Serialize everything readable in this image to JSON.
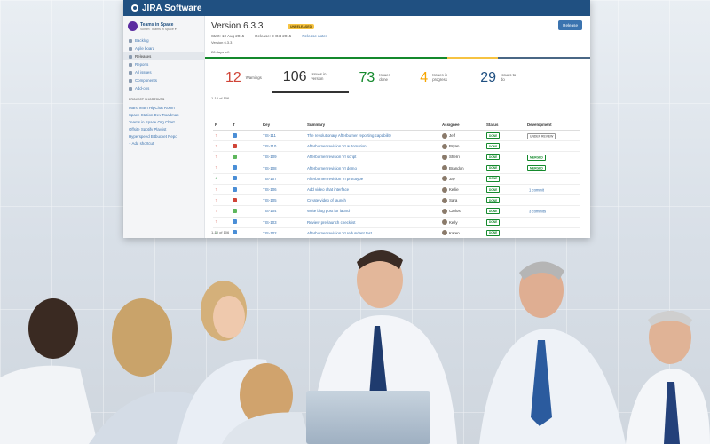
{
  "app": {
    "name": "JIRA Software"
  },
  "project": {
    "name": "Teams in Space",
    "board": "Scrum: Teams in Space ▾"
  },
  "sidebar": {
    "items": [
      {
        "label": "Backlog"
      },
      {
        "label": "Agile board"
      },
      {
        "label": "Releases"
      },
      {
        "label": "Reports"
      },
      {
        "label": "All issues"
      },
      {
        "label": "Components"
      },
      {
        "label": "Add-ons"
      }
    ],
    "shortcuts_heading": "PROJECT SHORTCUTS",
    "shortcuts": [
      "Mars Team HipChat Room",
      "Space Station Dev Roadmap",
      "Teams in Space Org Chart",
      "Offsite Spotify Playlist",
      "Hyperspeed Bitbucket Repo"
    ],
    "add_shortcut": "+ Add shortcut"
  },
  "version": {
    "title": "Version 6.3.3",
    "badge": "UNRELEASED",
    "start": "Start: 10 Aug 2015",
    "release": "Release: 9 Oct 2015",
    "notes_link": "Release notes",
    "subtitle": "Version 6.3.3",
    "release_button": "Release",
    "days_left": "28 days left",
    "progress": {
      "done": 0.63,
      "in_progress": 0.13,
      "todo": 0.24
    }
  },
  "stats": [
    {
      "num": "12",
      "label": "Warnings"
    },
    {
      "num": "106",
      "label": "Issues in version"
    },
    {
      "num": "73",
      "label": "Issues done"
    },
    {
      "num": "4",
      "label": "Issues in progress"
    },
    {
      "num": "29",
      "label": "Issues to-do"
    }
  ],
  "count_label": "1-10 of 106",
  "table": {
    "headers": [
      "P",
      "T",
      "Key",
      "Summary",
      "Assignee",
      "Status",
      "Development"
    ],
    "rows": [
      {
        "pri": "high",
        "type": "task",
        "key": "TIS-111",
        "summary": "The revolutionary Afterburner reporting capability",
        "assignee": "Jeff",
        "status": "DONE",
        "dev": "UNDER REVIEW",
        "dev_kind": "review"
      },
      {
        "pri": "high",
        "type": "bug",
        "key": "TIS-110",
        "summary": "Afterburner revision VI automation",
        "assignee": "Bryan",
        "status": "DONE",
        "dev": "",
        "dev_kind": ""
      },
      {
        "pri": "high",
        "type": "story",
        "key": "TIS-109",
        "summary": "Afterburner revision VI script",
        "assignee": "Sherri",
        "status": "DONE",
        "dev": "MERGED",
        "dev_kind": "merged"
      },
      {
        "pri": "high",
        "type": "task",
        "key": "TIS-108",
        "summary": "Afterburner revision VI demo",
        "assignee": "Brandon",
        "status": "DONE",
        "dev": "MERGED",
        "dev_kind": "merged"
      },
      {
        "pri": "low",
        "type": "task",
        "key": "TIS-107",
        "summary": "Afterburner revision VI prototype",
        "assignee": "Jay",
        "status": "DONE",
        "dev": "",
        "dev_kind": ""
      },
      {
        "pri": "high",
        "type": "task",
        "key": "TIS-106",
        "summary": "Add video chat interface",
        "assignee": "Kellie",
        "status": "DONE",
        "dev": "1 commit",
        "dev_kind": "commit"
      },
      {
        "pri": "high",
        "type": "bug",
        "key": "TIS-105",
        "summary": "Create video of launch",
        "assignee": "Sara",
        "status": "DONE",
        "dev": "",
        "dev_kind": ""
      },
      {
        "pri": "high",
        "type": "story",
        "key": "TIS-104",
        "summary": "Write blog post for launch",
        "assignee": "Carlos",
        "status": "DONE",
        "dev": "3 commits",
        "dev_kind": "commit"
      },
      {
        "pri": "high",
        "type": "task",
        "key": "TIS-103",
        "summary": "Review pre-launch checklist",
        "assignee": "Kelly",
        "status": "DONE",
        "dev": "",
        "dev_kind": ""
      },
      {
        "pri": "low",
        "type": "task",
        "key": "TIS-102",
        "summary": "Afterburner revision VI redundant test",
        "assignee": "Karen",
        "status": "DONE",
        "dev": "",
        "dev_kind": ""
      }
    ]
  },
  "colors": {
    "header": "#205081",
    "done": "#14892c",
    "progress": "#f6c342",
    "todo": "#4a6785",
    "warning": "#d04437"
  }
}
